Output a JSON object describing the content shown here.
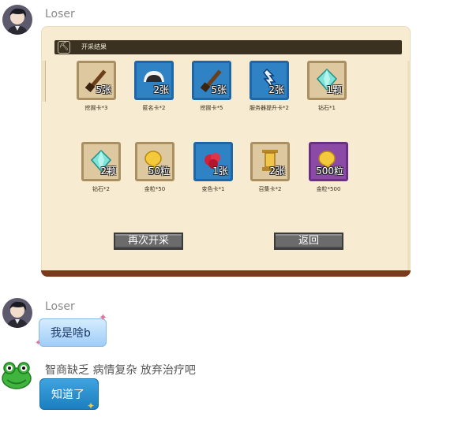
{
  "messages": [
    {
      "sender": "Loser"
    },
    {
      "sender": "Loser",
      "text": "我是啥b"
    },
    {
      "text": "智商缺乏 病情复杂 放弃治疗吧"
    },
    {
      "text": "知道了"
    }
  ],
  "game": {
    "header_title": "开采结果",
    "items": [
      {
        "qty": "5张",
        "caption": "挖掘卡*3",
        "icon": "shovel-icon"
      },
      {
        "qty": "2张",
        "caption": "匿名卡*2",
        "icon": "mask-icon"
      },
      {
        "qty": "5张",
        "caption": "挖掘卡*5",
        "icon": "shovel-icon"
      },
      {
        "qty": "2张",
        "caption": "服务器提升卡*2",
        "icon": "booster-icon"
      },
      {
        "qty": "1颗",
        "caption": "钻石*1",
        "icon": "diamond-icon"
      },
      {
        "qty": "2颗",
        "caption": "钻石*2",
        "icon": "diamond-icon"
      },
      {
        "qty": "50粒",
        "caption": "金粒*50",
        "icon": "gold-nugget-icon"
      },
      {
        "qty": "1张",
        "caption": "变色卡*1",
        "icon": "color-change-icon"
      },
      {
        "qty": "2张",
        "caption": "召集卡*2",
        "icon": "summon-icon"
      },
      {
        "qty": "500粒",
        "caption": "金粒*500",
        "icon": "gold-nugget-icon"
      }
    ],
    "buttons": {
      "again": "再次开采",
      "back": "返回"
    }
  }
}
